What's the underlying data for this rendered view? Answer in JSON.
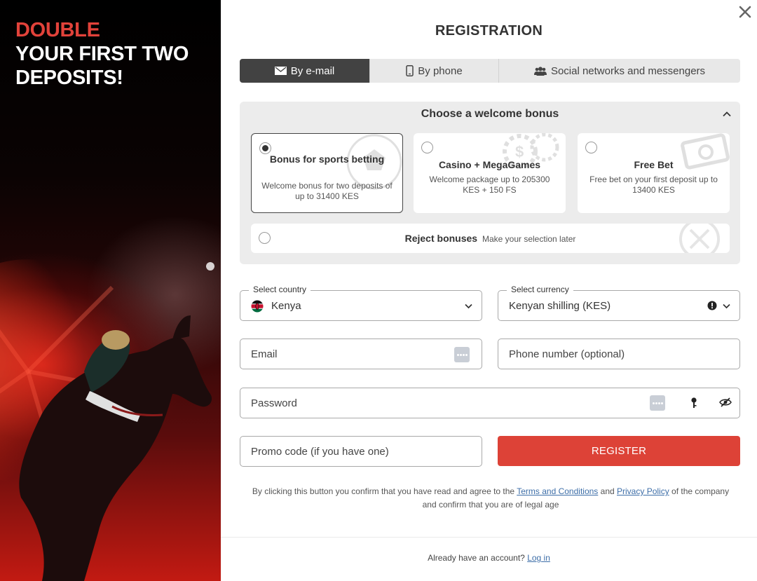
{
  "promo": {
    "title_line1": "DOUBLE",
    "title_line2": "YOUR FIRST TWO",
    "title_line3": "DEPOSITS!",
    "accent_color": "#e2423a"
  },
  "registration": {
    "heading": "REGISTRATION",
    "close_icon": "close-icon",
    "tabs": [
      {
        "label": "By e-mail",
        "icon": "envelope-icon",
        "active": true
      },
      {
        "label": "By phone",
        "icon": "phone-icon",
        "active": false
      },
      {
        "label": "Social networks and messengers",
        "icon": "users-icon",
        "active": false
      }
    ],
    "bonus": {
      "heading": "Choose a welcome bonus",
      "options": [
        {
          "title": "Bonus for sports betting",
          "description": "Welcome bonus for two deposits of up to 31400 KES",
          "selected": true,
          "icon": "soccer-ball-icon"
        },
        {
          "title": "Casino + MegaGames",
          "description": "Welcome package up to 205300 KES + 150 FS",
          "selected": false,
          "icon": "casino-chips-icon"
        },
        {
          "title": "Free Bet",
          "description": "Free bet on your first deposit up to 13400 KES",
          "selected": false,
          "icon": "ticket-icon"
        }
      ],
      "reject_title": "Reject bonuses",
      "reject_subtitle": "Make your selection later"
    },
    "country": {
      "label": "Select country",
      "value": "Kenya",
      "flag": "kenya-flag-icon"
    },
    "currency": {
      "label": "Select currency",
      "value": "Kenyan shilling (KES)"
    },
    "email": {
      "placeholder": "Email"
    },
    "phone": {
      "placeholder": "Phone number (optional)"
    },
    "password": {
      "placeholder": "Password"
    },
    "promo_code": {
      "placeholder": "Promo code (if you have one)"
    },
    "register_label": "REGISTER",
    "register_color": "#dd4237",
    "terms": {
      "before": "By clicking this button you confirm that you have read and agree to the",
      "terms_link": "Terms and Conditions",
      "and": "and",
      "privacy_link": "Privacy Policy",
      "after": "of the company and confirm that you are of legal age"
    },
    "footer": {
      "text": "Already have an account?",
      "login_link": "Log in"
    }
  }
}
